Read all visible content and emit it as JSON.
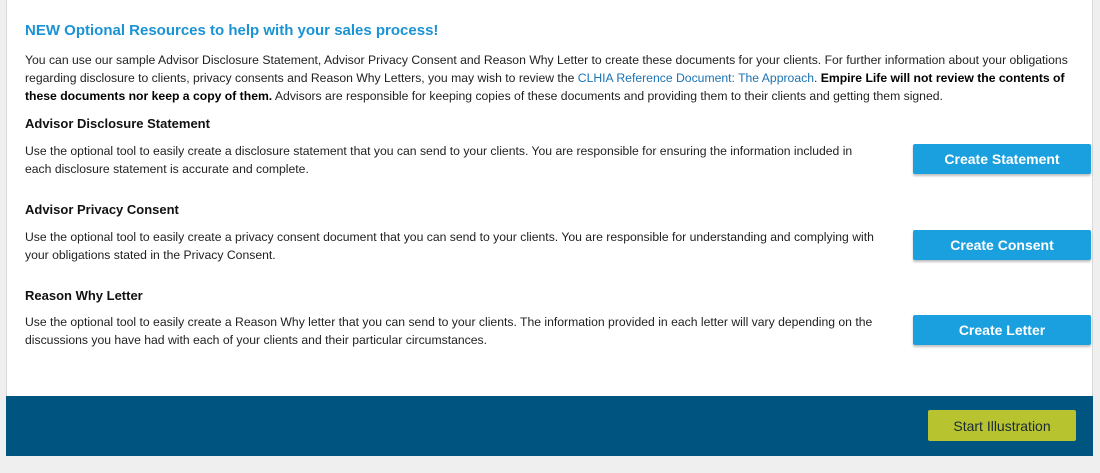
{
  "heading": "NEW Optional Resources to help with your sales process!",
  "intro": {
    "text_before_link": "You can use our sample Advisor Disclosure Statement, Advisor Privacy Consent and Reason Why Letter to create these documents for your clients. For further information about your obligations regarding disclosure to clients, privacy consents and Reason Why Letters, you may wish to review the ",
    "link_text": "CLHIA Reference Document: The Approach",
    "text_after_link": ". ",
    "bold_text": "Empire Life will not review the contents of these documents nor keep a copy of them.",
    "text_end": " Advisors are responsible for keeping copies of these documents and providing them to their clients and getting them signed."
  },
  "sections": [
    {
      "title": "Advisor Disclosure Statement",
      "description": "Use the optional tool to easily create a disclosure statement that you can send to your clients. You are responsible for ensuring the information included in each disclosure statement is accurate and complete.",
      "button_label": "Create Statement"
    },
    {
      "title": "Advisor Privacy Consent",
      "description": "Use the optional tool to easily create a privacy consent document that you can send to your clients. You are responsible for understanding and complying with your obligations stated in the Privacy Consent.",
      "button_label": "Create Consent"
    },
    {
      "title": "Reason Why Letter",
      "description": "Use the optional tool to easily create a Reason Why letter that you can send to your clients. The information provided in each letter will vary depending on the discussions you have had with each of your clients and their particular circumstances.",
      "button_label": "Create Letter"
    }
  ],
  "footer": {
    "start_button_label": "Start Illustration"
  },
  "colors": {
    "heading": "#1a93d4",
    "link": "#1b73b3",
    "action_button": "#1aa0de",
    "footer_bar": "#005580",
    "start_button": "#b8c42f"
  }
}
